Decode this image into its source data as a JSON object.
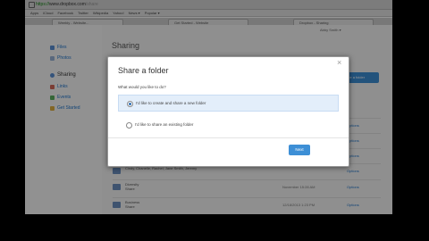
{
  "browser": {
    "url_scheme": "https://",
    "url_host": "www.dropbox.com",
    "url_path": "/share",
    "bookmarks": [
      "Apps",
      "iCloud",
      "Facebook",
      "Twitter",
      "Wikipedia",
      "Yahoo!",
      "News ▾",
      "Popular ▾"
    ],
    "tabs": [
      "Weebly - Website...",
      "Get Started - Website",
      "Dropbox - Sharing"
    ]
  },
  "page": {
    "title": "Sharing",
    "user": "Abby Smith ▾",
    "share_button": "Share a folder",
    "sidebar": [
      {
        "label": "Files",
        "icon": "folder-icon"
      },
      {
        "label": "Photos",
        "icon": "photos-icon"
      },
      {
        "label": "Sharing",
        "icon": "sharing-icon"
      },
      {
        "label": "Links",
        "icon": "link-icon"
      },
      {
        "label": "Events",
        "icon": "events-icon"
      },
      {
        "label": "Get Started",
        "icon": "star-icon"
      }
    ],
    "rows": [
      {
        "name": "",
        "date": "",
        "option": "Options"
      },
      {
        "name": "",
        "date": "",
        "option": "Options"
      },
      {
        "name": "",
        "date": "",
        "option": "Options"
      },
      {
        "name": "Cindy, Chanelle, Rachel, Jane Smith, Jeremy",
        "date": "",
        "option": "Options"
      },
      {
        "name": "Diversity\nShare",
        "date": "November 15:28 AM",
        "option": "Options"
      },
      {
        "name": "Business\nShare",
        "date": "12/18/2013 1:23 PM",
        "option": "Options"
      }
    ]
  },
  "modal": {
    "title": "Share a folder",
    "close_glyph": "×",
    "question": "What would you like to do?",
    "options": [
      {
        "label": "I'd like to create and share a new folder",
        "selected": true
      },
      {
        "label": "I'd like to share an existing folder",
        "selected": false
      }
    ],
    "next_label": "Next"
  },
  "colors": {
    "accent": "#3d8fd6",
    "link": "#1f75cc",
    "selected_bg": "#e3eefa"
  }
}
